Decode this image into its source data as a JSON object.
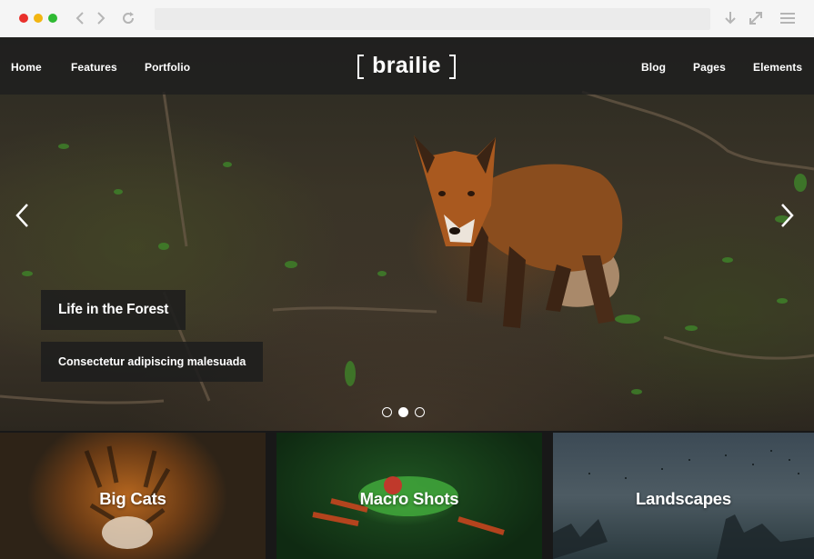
{
  "browser": {
    "address": "",
    "icons": [
      "back-arrow-icon",
      "forward-arrow-icon",
      "reload-icon",
      "download-icon",
      "expand-icon",
      "menu-icon"
    ]
  },
  "nav": {
    "left": [
      {
        "label": "Home"
      },
      {
        "label": "Features"
      },
      {
        "label": "Portfolio"
      }
    ],
    "right": [
      {
        "label": "Blog"
      },
      {
        "label": "Pages"
      },
      {
        "label": "Elements"
      }
    ],
    "logo": "brailie"
  },
  "slider": {
    "title": "Life in the Forest",
    "subtitle": "Consectetur adipiscing malesuada",
    "slide_count": 3,
    "active_slide": 2
  },
  "tiles": [
    {
      "label": "Big Cats"
    },
    {
      "label": "Macro Shots"
    },
    {
      "label": "Landscapes"
    }
  ],
  "colors": {
    "nav_bg": "#1e1e1e",
    "text": "#ffffff",
    "chrome_bg": "#f5f5f5"
  }
}
